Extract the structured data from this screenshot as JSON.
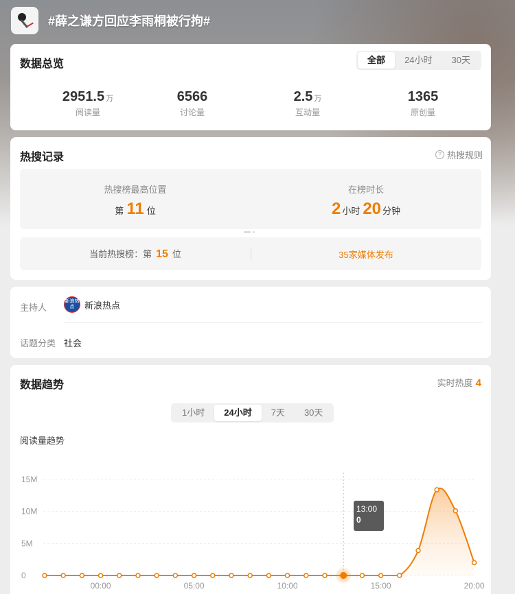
{
  "header": {
    "title": "#薛之谦方回应李雨桐被行拘#",
    "logo_icon": "microphone-icon"
  },
  "overview": {
    "title": "数据总览",
    "tabs": [
      "全部",
      "24小时",
      "30天"
    ],
    "active_tab": 0,
    "stats": [
      {
        "value": "2951.5",
        "unit": "万",
        "label": "阅读量"
      },
      {
        "value": "6566",
        "unit": "",
        "label": "讨论量"
      },
      {
        "value": "2.5",
        "unit": "万",
        "label": "互动量"
      },
      {
        "value": "1365",
        "unit": "",
        "label": "原创量"
      }
    ]
  },
  "hot": {
    "title": "热搜记录",
    "rule": "热搜规则",
    "peak_label": "热搜榜最高位置",
    "peak_prefix": "第",
    "peak_value": "11",
    "peak_suffix": "位",
    "duration_label": "在榜时长",
    "hours": "2",
    "hours_unit": "小时",
    "minutes": "20",
    "minutes_unit": "分钟",
    "current_prefix": "当前热搜榜：第",
    "current_value": "15",
    "current_suffix": "位",
    "media": "35家媒体发布"
  },
  "host": {
    "host_label": "主持人",
    "host_name": "新浪热点",
    "host_avatar_text": "新浪热点",
    "category_label": "话题分类",
    "category": "社会"
  },
  "trend": {
    "title": "数据趋势",
    "heat_label": "实时热度",
    "heat_value": "4",
    "tabs": [
      "1小时",
      "24小时",
      "7天",
      "30天"
    ],
    "active_tab": 1,
    "sub_title": "阅读量趋势",
    "tooltip_time": "13:00",
    "tooltip_value": "0"
  },
  "colors": {
    "accent": "#f07c00",
    "line": "#f07c00"
  },
  "chart_data": {
    "type": "area",
    "y_tick_labels": [
      "0",
      "5M",
      "10M",
      "15M"
    ],
    "yticks": [
      0,
      5000000,
      10000000,
      15000000
    ],
    "ylim": [
      0,
      16000000
    ],
    "x_tick_labels": [
      "00:00",
      "05:00",
      "10:00",
      "15:00",
      "20:00"
    ],
    "series": [
      {
        "values": [
          0,
          0,
          0,
          0,
          0,
          0,
          0,
          0,
          0,
          0,
          0,
          0,
          0,
          0,
          0,
          0,
          0,
          0,
          0,
          0,
          3900000,
          13400000,
          10100000,
          2000000
        ],
        "highlight_index": 16
      }
    ]
  }
}
